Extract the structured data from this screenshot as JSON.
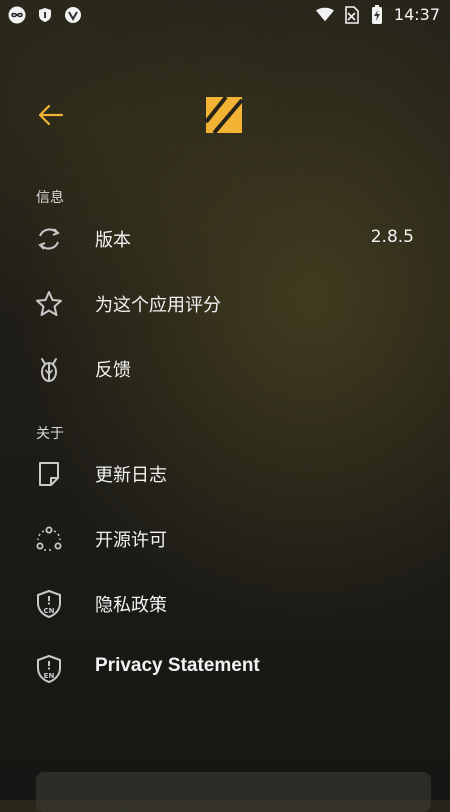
{
  "status_bar": {
    "time": "14:37",
    "left_icons": [
      "infinity-icon",
      "shield-icon",
      "v-shield-icon"
    ],
    "right_icons": [
      "wifi-icon",
      "no-sim-icon",
      "battery-icon"
    ]
  },
  "header": {
    "back_icon": "arrow-left-icon",
    "logo_icon": "app-logo-icon",
    "accent_color": "#f2b233"
  },
  "sections": [
    {
      "title": "信息",
      "items": [
        {
          "icon": "sync-icon",
          "label": "版本",
          "value": "2.8.5"
        },
        {
          "icon": "star-icon",
          "label": "为这个应用评分"
        },
        {
          "icon": "bug-icon",
          "label": "反馈"
        }
      ]
    },
    {
      "title": "关于",
      "items": [
        {
          "icon": "note-icon",
          "label": "更新日志"
        },
        {
          "icon": "open-source-icon",
          "label": "开源许可"
        },
        {
          "icon": "privacy-cn-icon",
          "label": "隐私政策",
          "badge": "CN"
        },
        {
          "icon": "privacy-en-icon",
          "label": "Privacy Statement",
          "badge": "EN"
        }
      ]
    }
  ]
}
